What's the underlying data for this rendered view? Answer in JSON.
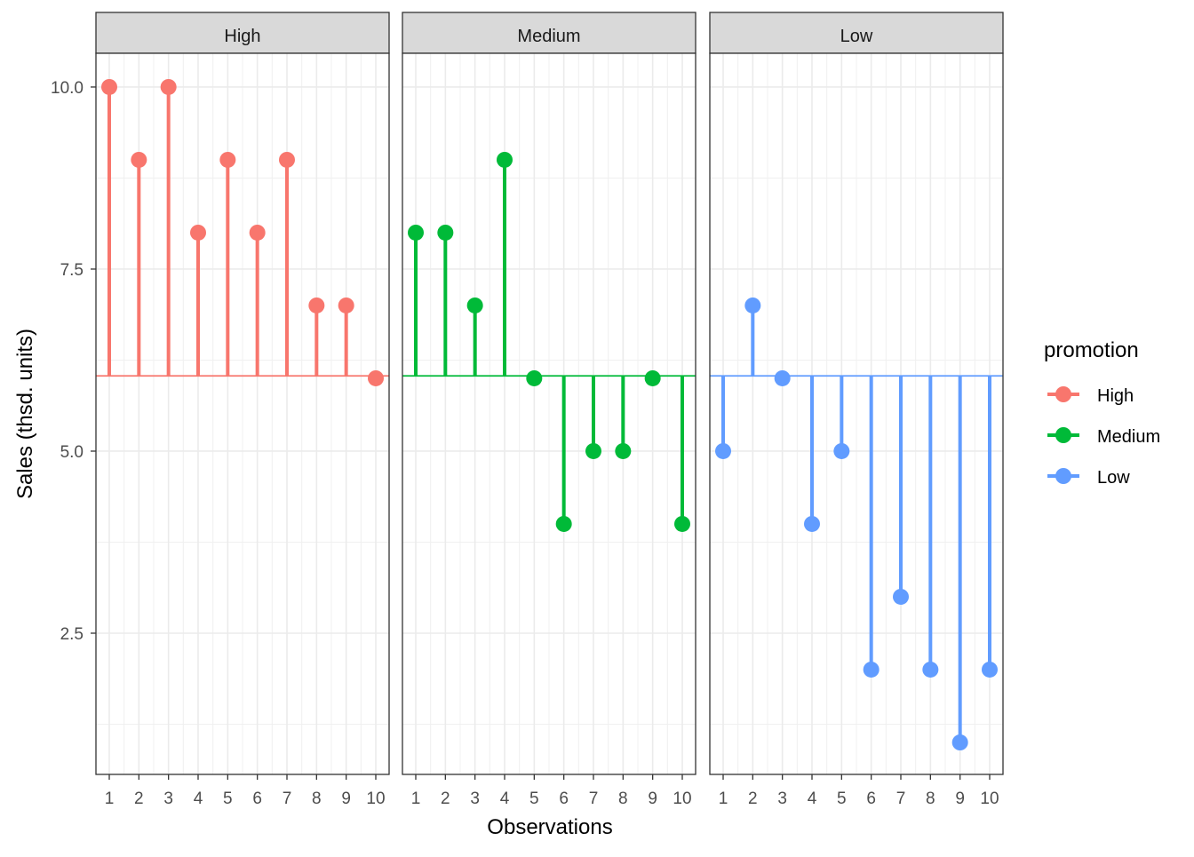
{
  "chart_data": {
    "type": "lollipop",
    "facet_by": "promotion",
    "xlabel": "Observations",
    "ylabel": "Sales (thsd. units)",
    "xlim": [
      0.55,
      10.45
    ],
    "ylim": [
      0.561,
      10.463
    ],
    "x_ticks": [
      1,
      2,
      3,
      4,
      5,
      6,
      7,
      8,
      9,
      10
    ],
    "y_ticks": [
      2.5,
      5.0,
      7.5,
      10.0
    ],
    "y_tick_labels": [
      "2.5",
      "5.0",
      "7.5",
      "10.0"
    ],
    "baseline": 6.0333,
    "grid": true,
    "legend": {
      "title": "promotion",
      "placement": "right"
    },
    "series": [
      {
        "name": "High",
        "color": "#F8766D",
        "x": [
          1,
          2,
          3,
          4,
          5,
          6,
          7,
          8,
          9,
          10
        ],
        "values": [
          10,
          9,
          10,
          8,
          9,
          8,
          9,
          7,
          7,
          6
        ]
      },
      {
        "name": "Medium",
        "color": "#00BA38",
        "x": [
          1,
          2,
          3,
          4,
          5,
          6,
          7,
          8,
          9,
          10
        ],
        "values": [
          8,
          8,
          7,
          9,
          6,
          4,
          5,
          5,
          6,
          4
        ]
      },
      {
        "name": "Low",
        "color": "#619CFF",
        "x": [
          1,
          2,
          3,
          4,
          5,
          6,
          7,
          8,
          9,
          10
        ],
        "values": [
          5,
          7,
          6,
          4,
          5,
          2,
          3,
          2,
          1,
          2
        ]
      }
    ]
  }
}
